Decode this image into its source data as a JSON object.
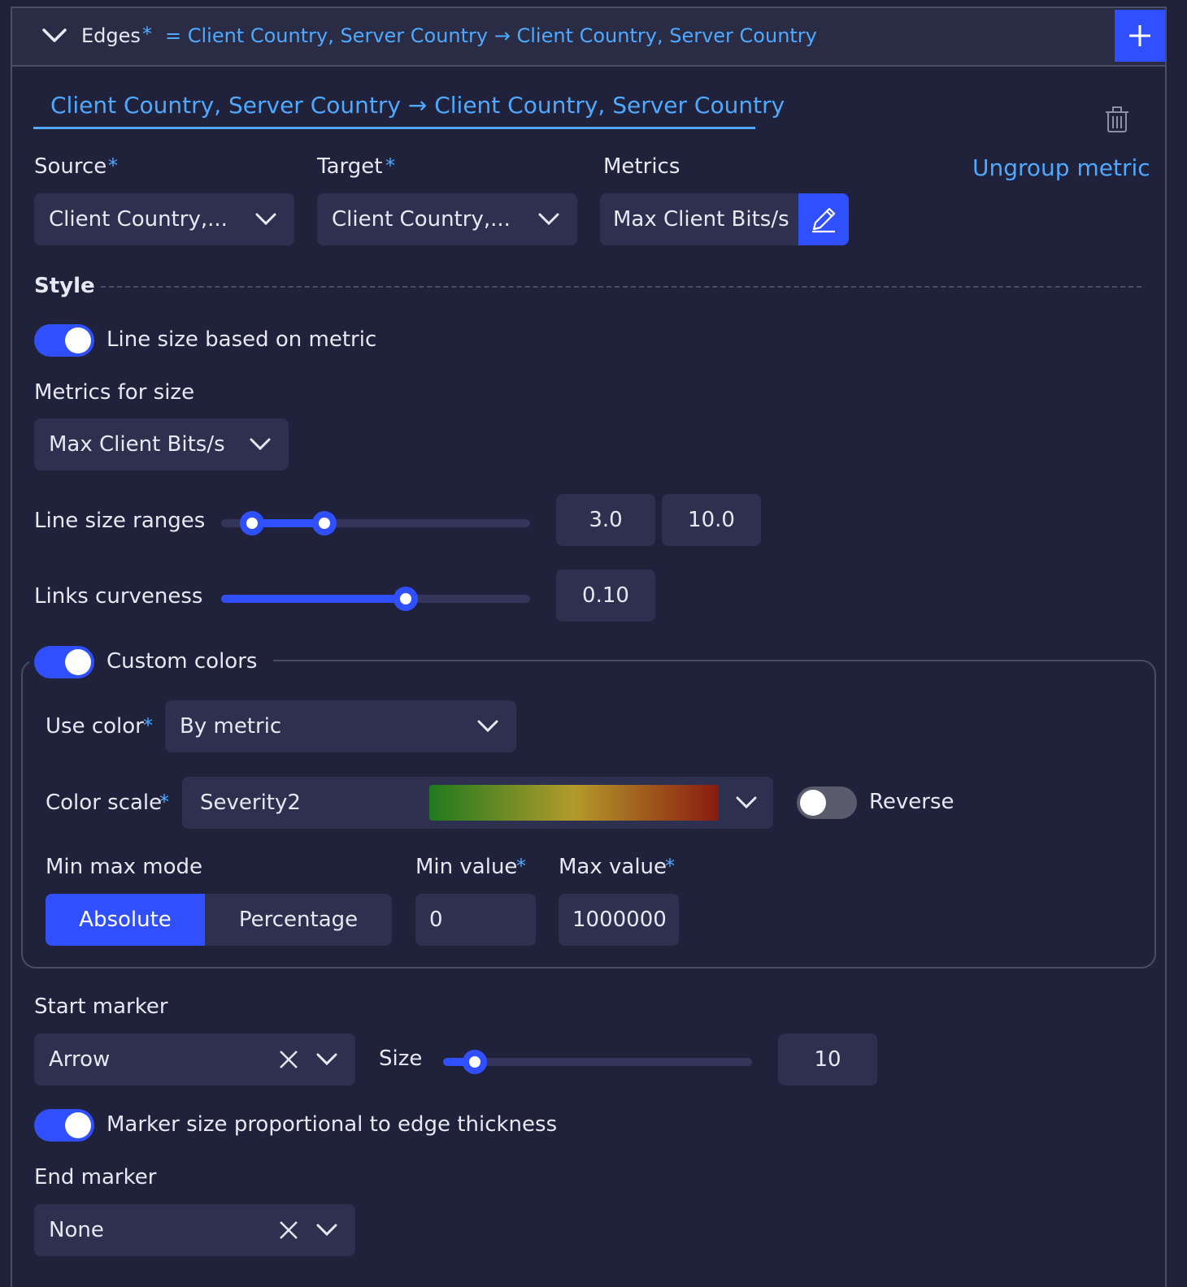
{
  "header": {
    "title": "Edges",
    "required_mark": "*",
    "summary": "= Client Country, Server Country → Client Country, Server Country",
    "add_label": "+"
  },
  "tab": {
    "label": "Client Country, Server Country → Client Country, Server Country"
  },
  "fields": {
    "source_label": "Source",
    "source_value": "Client Country,...",
    "target_label": "Target",
    "target_value": "Client Country,...",
    "metrics_label": "Metrics",
    "metrics_value": "Max Client Bits/s",
    "ungroup_link": "Ungroup metric"
  },
  "style": {
    "heading": "Style",
    "line_size_toggle_label": "Line size based on metric",
    "line_size_toggle_on": true,
    "metrics_for_size_label": "Metrics for size",
    "metrics_for_size_value": "Max Client Bits/s",
    "line_size_ranges_label": "Line size ranges",
    "line_size_min": "3.0",
    "line_size_max": "10.0",
    "links_curveness_label": "Links curveness",
    "links_curveness_value": "0.10",
    "custom_colors_label": "Custom colors",
    "custom_colors_on": true
  },
  "colors": {
    "use_color_label": "Use color",
    "use_color_value": "By metric",
    "color_scale_label": "Color scale",
    "color_scale_value": "Severity2",
    "scale_gradient": [
      "#1f7a1f",
      "#b39a2a",
      "#8a1a10"
    ],
    "reverse_label": "Reverse",
    "reverse_on": false,
    "min_max_mode_label": "Min max mode",
    "mode_absolute": "Absolute",
    "mode_percentage": "Percentage",
    "mode_selected": "Absolute",
    "min_value_label": "Min value",
    "min_value": "0",
    "max_value_label": "Max value",
    "max_value": "1000000"
  },
  "markers": {
    "start_marker_label": "Start marker",
    "start_marker_value": "Arrow",
    "size_label": "Size",
    "size_value": "10",
    "proportional_label": "Marker size proportional to edge thickness",
    "proportional_on": true,
    "end_marker_label": "End marker",
    "end_marker_value": "None"
  },
  "theme": {
    "accent": "#3050ff",
    "link": "#4ea9ff",
    "background": "#20213a",
    "field": "#2e3050"
  }
}
